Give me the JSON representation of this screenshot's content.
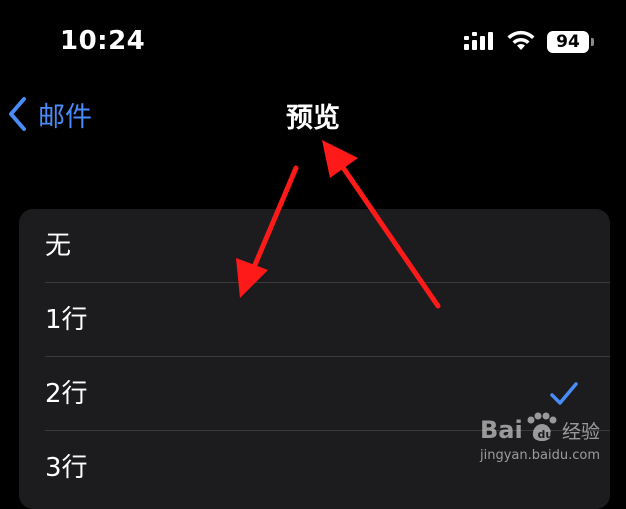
{
  "status_bar": {
    "time": "10:24",
    "battery_level": "94",
    "icons": [
      "cellular-signal-icon",
      "wifi-icon",
      "battery-icon"
    ]
  },
  "nav": {
    "back_label": "邮件",
    "title": "预览",
    "back_icon": "chevron-left-icon"
  },
  "preview_options": {
    "items": [
      {
        "label": "无",
        "selected": false
      },
      {
        "label": "1行",
        "selected": false
      },
      {
        "label": "2行",
        "selected": true
      },
      {
        "label": "3行",
        "selected": false
      }
    ]
  },
  "watermark": {
    "brand_text": "Bai 经验",
    "url": "jingyan.baidu.com"
  },
  "colors": {
    "background": "#000000",
    "list_background": "#1c1c1e",
    "accent": "#4a8cf7",
    "annotation_arrow": "#ff1a1a",
    "divider": "#3a3a3c"
  }
}
